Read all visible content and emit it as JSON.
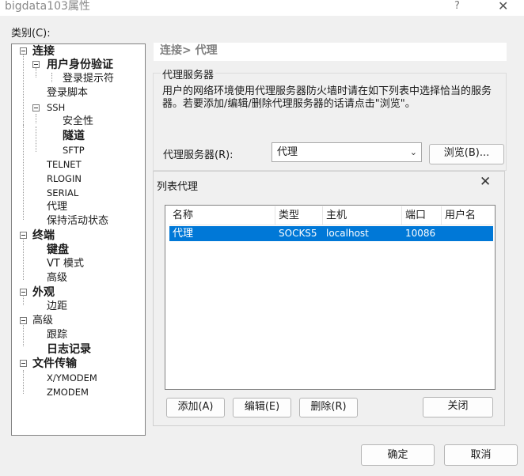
{
  "window": {
    "title": "bigdata103属性",
    "help_glyph": "?",
    "close_glyph": "✕"
  },
  "category_label": "类别(C):",
  "tree": {
    "connection": "连接",
    "user_auth": "用户身份验证",
    "login_prompt": "登录提示符",
    "login_script": "登录脚本",
    "ssh": "SSH",
    "security": "安全性",
    "tunnel": "隧道",
    "sftp": "SFTP",
    "telnet": "TELNET",
    "rlogin": "RLOGIN",
    "serial": "SERIAL",
    "proxy": "代理",
    "keepalive": "保持活动状态",
    "terminal": "终端",
    "keyboard": "键盘",
    "vt_mode": "VT 模式",
    "advanced": "高级",
    "appearance": "外观",
    "margin": "边距",
    "advanced2": "高级",
    "trace": "跟踪",
    "logging": "日志记录",
    "file_transfer": "文件传输",
    "xymodem": "X/YMODEM",
    "zmodem": "ZMODEM"
  },
  "breadcrumb": "连接> 代理",
  "proxy_server_group": {
    "title": "代理服务器",
    "description": "用户的网络环境使用代理服务器防火墙时请在如下列表中选择恰当的服务器。若要添加/编辑/删除代理服务器的话请点击\"浏览\"。",
    "field_label": "代理服务器(R):",
    "selected_value": "代理",
    "browse_button": "浏览(B)..."
  },
  "proxy_list_dialog": {
    "title": "列表代理",
    "columns": [
      "名称",
      "类型",
      "主机",
      "端口",
      "用户名"
    ],
    "rows": [
      {
        "name": "代理",
        "type": "SOCKS5",
        "host": "localhost",
        "port": "10086",
        "user": ""
      }
    ],
    "add_button": "添加(A)",
    "edit_button": "编辑(E)",
    "delete_button": "删除(R)",
    "close_button": "关闭"
  },
  "ok_button": "确定",
  "cancel_button": "取消"
}
